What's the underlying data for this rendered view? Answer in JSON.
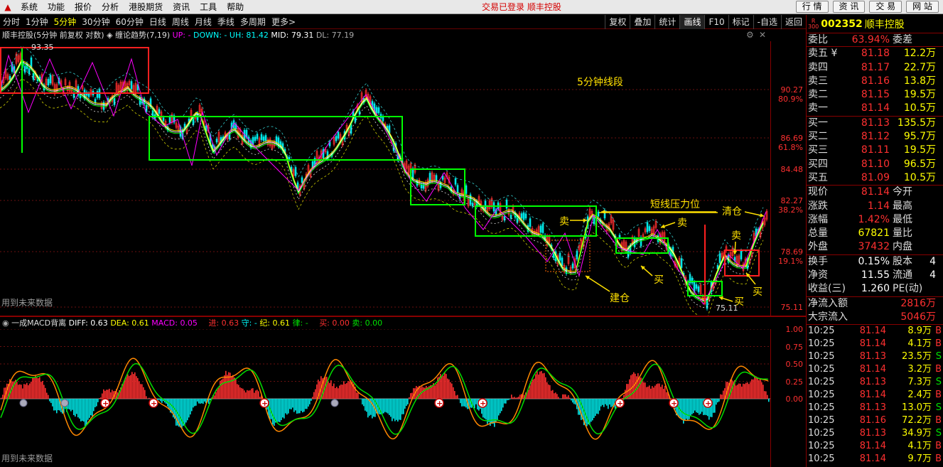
{
  "menubar": {
    "items": [
      "系统",
      "功能",
      "报价",
      "分析",
      "港股期货",
      "资讯",
      "工具",
      "帮助"
    ],
    "status": "交易已登录  顺丰控股",
    "buttons": [
      "行 情",
      "资 讯",
      "交 易",
      "网 站"
    ]
  },
  "tabs": {
    "left": [
      "分时",
      "1分钟",
      "5分钟",
      "30分钟",
      "60分钟",
      "日线",
      "周线",
      "月线",
      "季线",
      "多周期",
      "更多>"
    ],
    "active": "5分钟",
    "right": [
      "复权",
      "叠加",
      "统计",
      "画线",
      "F10",
      "标记",
      "-自选",
      "返回"
    ],
    "right_active": "画线"
  },
  "main_info": {
    "title": "顺丰控股(5分钟 前复权 对数)",
    "indicator": "缠论趋势(7,19)",
    "up": "UP: -",
    "down": "DOWN: -",
    "uh": "UH: 81.42",
    "mid": "MID: 79.31",
    "dl": "DL: 77.19"
  },
  "main_axis": [
    {
      "price": "90.27",
      "pct": "80.9%"
    },
    {
      "price": "86.69",
      "pct": "61.8%"
    },
    {
      "price": "84.48",
      "pct": ""
    },
    {
      "price": "82.27",
      "pct": "38.2%"
    },
    {
      "price": "78.69",
      "pct": "19.1%"
    },
    {
      "price": "75.11",
      "pct": ""
    }
  ],
  "annotations": {
    "segment_label": "5分钟线段",
    "pressure": "短线压力位",
    "clear": "清仓",
    "sell1": "卖",
    "sell2": "卖",
    "sell3": "卖",
    "buy1": "买",
    "buy2": "买",
    "buy3": "买",
    "build": "建仓",
    "high_price": "93.35",
    "low_price": "75.11",
    "future_main": "用到未来数据",
    "future_sub": "用到未来数据"
  },
  "sub_info": {
    "title": "一成MACD背离",
    "diff": "DIFF: 0.63",
    "dea": "DEA: 0.61",
    "macd": "MACD: 0.05",
    "attack": "进: 0.63",
    "guard": "守: -",
    "ji": "纪: 0.61",
    "lu": "律: -",
    "buy": "买: 0.00",
    "sell": "卖: 0.00"
  },
  "sub_axis": [
    "1.00",
    "0.75",
    "0.50",
    "0.25",
    "0.00"
  ],
  "quote": {
    "r_badge": "R\n300",
    "code": "002352",
    "name": "顺丰控股",
    "weibi_label": "委比",
    "weibi_value": "63.94%",
    "weicha_label": "委差",
    "asks": [
      {
        "label": "卖五 ¥",
        "price": "81.18",
        "vol": "12.2万"
      },
      {
        "label": "卖四",
        "price": "81.17",
        "vol": "22.7万"
      },
      {
        "label": "卖三",
        "price": "81.16",
        "vol": "13.8万"
      },
      {
        "label": "卖二",
        "price": "81.15",
        "vol": "19.5万"
      },
      {
        "label": "卖一",
        "price": "81.14",
        "vol": "10.5万"
      }
    ],
    "bids": [
      {
        "label": "买一",
        "price": "81.13",
        "vol": "135.5万"
      },
      {
        "label": "买二",
        "price": "81.12",
        "vol": "95.7万"
      },
      {
        "label": "买三",
        "price": "81.11",
        "vol": "19.5万"
      },
      {
        "label": "买四",
        "price": "81.10",
        "vol": "96.5万"
      },
      {
        "label": "买五",
        "price": "81.09",
        "vol": "10.5万"
      }
    ],
    "stats": [
      {
        "label": "现价",
        "value": "81.14",
        "label2": "今开",
        "color": "red"
      },
      {
        "label": "涨跌",
        "value": "1.14",
        "label2": "最高",
        "color": "red"
      },
      {
        "label": "涨幅",
        "value": "1.42%",
        "label2": "最低",
        "color": "red"
      },
      {
        "label": "总量",
        "value": "67821",
        "label2": "量比",
        "color": "yel"
      },
      {
        "label": "外盘",
        "value": "37432",
        "label2": "内盘",
        "color": "red"
      }
    ],
    "stats2": [
      {
        "label": "换手",
        "value": "0.15%",
        "label2": "股本",
        "extra": "4"
      },
      {
        "label": "净资",
        "value": "11.55",
        "label2": "流通",
        "extra": "4"
      },
      {
        "label": "收益(三)",
        "value": "1.260",
        "label2": "PE(动)",
        "extra": ""
      }
    ],
    "flows": [
      {
        "label": "净流入额",
        "value": "2816万"
      },
      {
        "label": "大宗流入",
        "value": "5046万"
      }
    ],
    "ticks": [
      {
        "time": "10:25",
        "price": "81.14",
        "vol": "8.9万",
        "flag": "B"
      },
      {
        "time": "10:25",
        "price": "81.14",
        "vol": "4.1万",
        "flag": "B"
      },
      {
        "time": "10:25",
        "price": "81.13",
        "vol": "23.5万",
        "flag": "S"
      },
      {
        "time": "10:25",
        "price": "81.14",
        "vol": "3.2万",
        "flag": "B"
      },
      {
        "time": "10:25",
        "price": "81.13",
        "vol": "7.3万",
        "flag": "S"
      },
      {
        "time": "10:25",
        "price": "81.14",
        "vol": "2.4万",
        "flag": "B"
      },
      {
        "time": "10:25",
        "price": "81.13",
        "vol": "13.0万",
        "flag": "S"
      },
      {
        "time": "10:25",
        "price": "81.16",
        "vol": "72.2万",
        "flag": "B"
      },
      {
        "time": "10:25",
        "price": "81.13",
        "vol": "34.9万",
        "flag": "S"
      },
      {
        "time": "10:25",
        "price": "81.14",
        "vol": "4.1万",
        "flag": "B"
      },
      {
        "time": "10:25",
        "price": "81.14",
        "vol": "9.7万",
        "flag": "B"
      }
    ]
  }
}
